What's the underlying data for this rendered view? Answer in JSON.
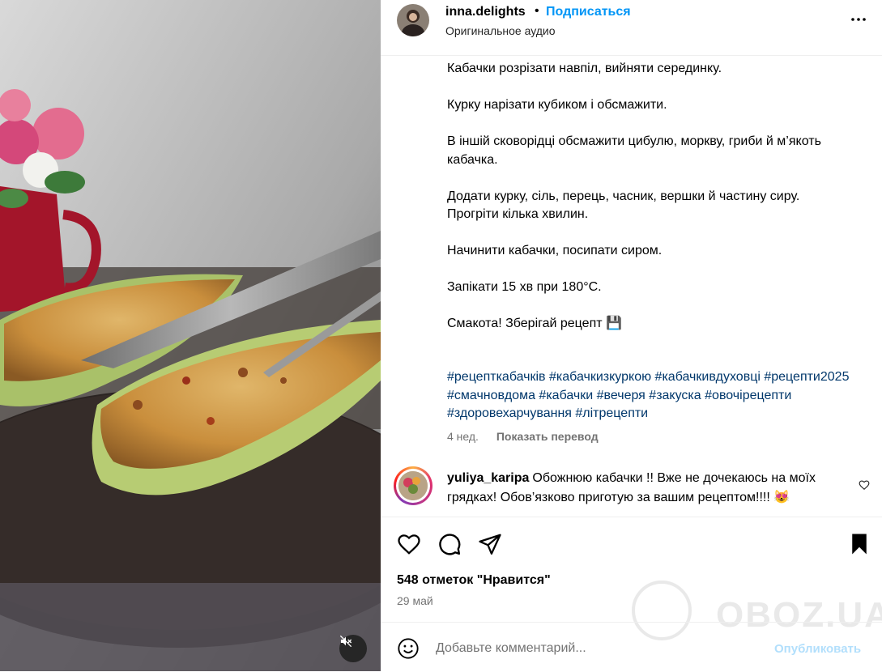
{
  "post": {
    "username": "inna.delights",
    "dot": "•",
    "follow_label": "Подписаться",
    "audio_label": "Оригинальное аудио",
    "more_icon": "more-horizontal-icon"
  },
  "caption": {
    "lines": [
      "Кабачки розрізати навпіл, вийняти серединку.",
      "Курку нарізати кубиком і обсмажити.",
      "В іншій сковорідці обсмажити цибулю, моркву, гриби й м’якоть кабачка.",
      "Додати курку, сіль, перець, часник, вершки й частину сиру. Прогріти кілька хвилин.",
      "Начинити кабачки, посипати сиром.",
      "Запікати 15 хв при 180°C.",
      "Смакота! Зберігай рецепт 💾"
    ],
    "hashtags": [
      "#рецепткабачків",
      "#кабачкизкуркою",
      "#кабачкивдуховці",
      "#рецепти2025",
      "#смачновдома",
      "#кабачки",
      "#вечеря",
      "#закуска",
      "#овочірецепти",
      "#здоровехарчування",
      "#літрецепти"
    ],
    "age": "4 нед.",
    "translate_label": "Показать перевод"
  },
  "comment": {
    "username": "yuliya_karipa",
    "text": "Обожнюю кабачки !! Вже не дочекаюсь на моїх грядках! Обов’язково приготую за вашим рецептом!!!! 😻"
  },
  "actions": {
    "icons": [
      "heart-icon",
      "comment-icon",
      "share-icon",
      "bookmark-icon"
    ]
  },
  "likes_text": "548 отметок \"Нравится\"",
  "date_text": "29 май",
  "add_comment": {
    "placeholder": "Добавьте комментарий...",
    "publish_label": "Опубликовать"
  },
  "watermark": "OBOZ.UA",
  "colors": {
    "link_blue": "#0095f6",
    "hashtag": "#00376b",
    "muted": "#737373",
    "publish_disabled": "#b2dffc"
  }
}
